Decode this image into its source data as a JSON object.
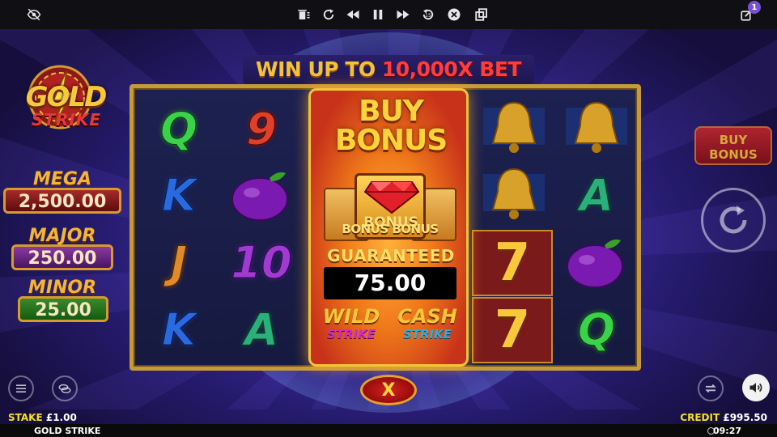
{
  "toolbar": {
    "icons": [
      "eye-off-icon",
      "trash-icon",
      "replay-icon",
      "rewind-icon",
      "pause-icon",
      "fast-forward-icon",
      "skip-back-icon",
      "close-circle-icon",
      "copy-icon",
      "edit-icon"
    ],
    "notification_count": "1"
  },
  "banner": {
    "prefix": "WIN UP TO ",
    "highlight": "10,000X BET"
  },
  "logo": {
    "line1": "GOLD",
    "line2": "STRIKE"
  },
  "jackpots": {
    "mega": {
      "label": "MEGA",
      "value": "2,500.00"
    },
    "major": {
      "label": "MAJOR",
      "value": "250.00"
    },
    "minor": {
      "label": "MINOR",
      "value": "25.00"
    }
  },
  "reels": {
    "col1": [
      "Q",
      "K",
      "J",
      "K"
    ],
    "col2": [
      "9",
      "plum",
      "10",
      "A"
    ],
    "col4": [
      "bell",
      "bell",
      "7",
      "7"
    ],
    "col5": [
      "bell",
      "A",
      "plum",
      "Q"
    ]
  },
  "buy_panel": {
    "title_line1": "BUY",
    "title_line2": "BONUS",
    "card_label": "BONUS",
    "card_side_text": "BONUS BONUS",
    "guaranteed": "GUARANTEED",
    "price": "75.00",
    "feature1_line1": "WILD",
    "feature1_line2": "STRIKE",
    "feature2_line1": "CASH",
    "feature2_line2": "STRIKE"
  },
  "close_button": {
    "label": "X"
  },
  "side_buy": {
    "line1": "BUY",
    "line2": "BONUS"
  },
  "footer": {
    "stake_label": "STAKE ",
    "stake_value": "£1.00",
    "credit_label": "CREDIT ",
    "credit_value": "£995.50",
    "game_name": "GOLD STRIKE",
    "time": "09:27"
  },
  "colors": {
    "accent_gold": "#f6c23a",
    "label_yellow": "#f4e21a",
    "panel_orange": "#f07a1a"
  }
}
